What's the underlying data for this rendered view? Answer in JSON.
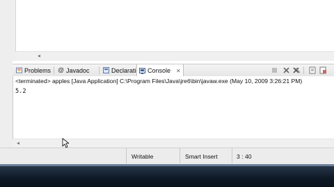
{
  "tabs": [
    {
      "label": "Problems",
      "icon": "problems-icon"
    },
    {
      "label": "Javadoc",
      "icon": "javadoc-icon"
    },
    {
      "label": "Declaration",
      "icon": "declaration-icon"
    },
    {
      "label": "Console",
      "icon": "console-icon",
      "active": true,
      "close": "✕"
    }
  ],
  "console": {
    "header": "<terminated> apples [Java Application] C:\\Program Files\\Java\\jre6\\bin\\javaw.exe (May 10, 2009 3:26:21 PM)",
    "output": "5.2"
  },
  "status": {
    "writable": "Writable",
    "insert_mode": "Smart Insert",
    "position": "3 : 40"
  },
  "colors": {
    "taskbar": "#1a2533",
    "tab_active": "#ffffff"
  }
}
